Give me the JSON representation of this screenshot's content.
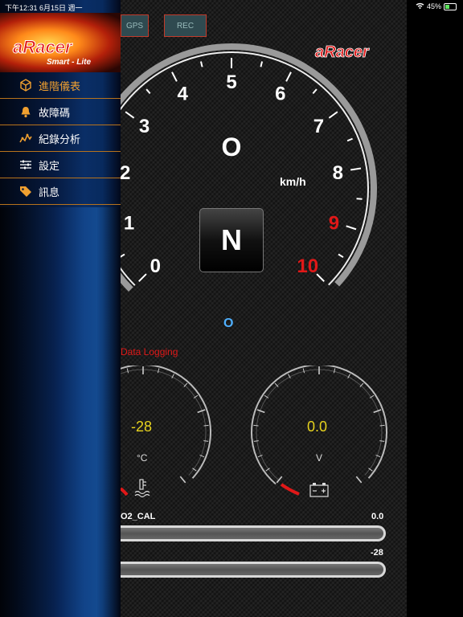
{
  "status_bar": {
    "time_date": "下午12:31   6月15日 週一",
    "battery_percent": "45%",
    "battery_level": 0.45,
    "wifi_icon": "wifi-icon"
  },
  "sidebar": {
    "brand": "aRacer",
    "brand_sub": "Smart - Lite",
    "items": [
      {
        "label": "進階儀表",
        "icon": "cube-icon",
        "active": true
      },
      {
        "label": "故障碼",
        "icon": "bell-icon",
        "active": false
      },
      {
        "label": "紀錄分析",
        "icon": "analytics-icon",
        "active": false
      },
      {
        "label": "設定",
        "icon": "sliders-icon",
        "active": false
      },
      {
        "label": "訊息",
        "icon": "tag-icon",
        "active": false
      }
    ]
  },
  "toolbar": {
    "gps_label": "GPS",
    "rec_label": "REC"
  },
  "header_brand": "aRacer",
  "tachometer": {
    "numbers": [
      "0",
      "1",
      "2",
      "3",
      "4",
      "5",
      "6",
      "7",
      "8",
      "9",
      "10"
    ],
    "redline_numbers": [
      "9",
      "10"
    ],
    "speed_value": "O",
    "speed_unit": "km/h",
    "gear": "N",
    "indicator": "O"
  },
  "data_logging_label": "Data Logging",
  "gauges": {
    "temperature": {
      "value": "-28",
      "unit": "°C",
      "icon": "coolant-temp-icon"
    },
    "voltage": {
      "value": "0.0",
      "unit": "V",
      "icon": "battery-icon"
    }
  },
  "bars": [
    {
      "label": "O2_CAL",
      "value": "0.0"
    },
    {
      "label": "",
      "value": "-28"
    }
  ],
  "colors": {
    "accent": "#f0a030",
    "redline": "#e01818",
    "gauge_value": "#e6d21e",
    "indicator_blue": "#4fb0ff"
  }
}
